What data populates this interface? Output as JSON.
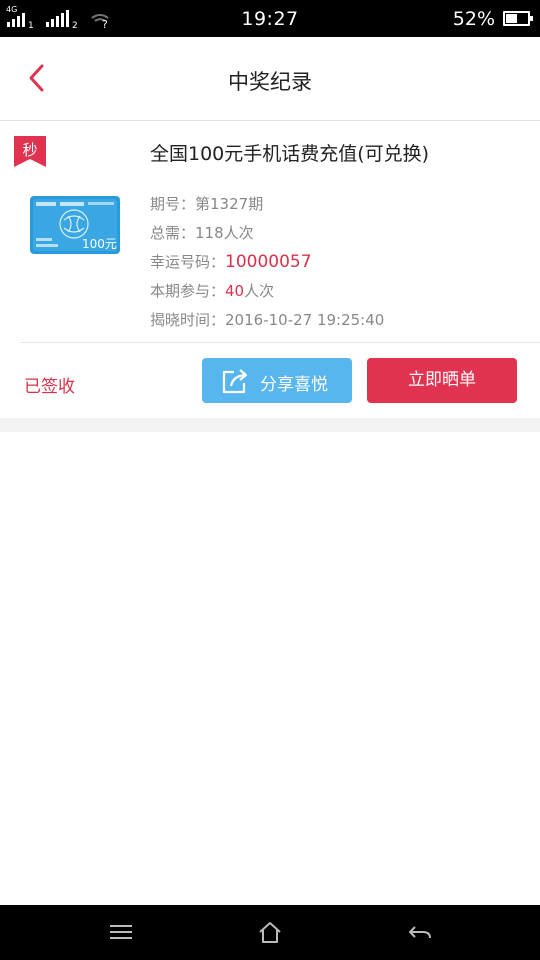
{
  "status_bar": {
    "network_type": "4G",
    "sim1": "1",
    "sim2": "2",
    "wifi_unknown": "?",
    "time": "19:27",
    "battery_percent": "52%",
    "battery_level": 0.52
  },
  "header": {
    "title": "中奖纪录",
    "back_icon": "chevron-left-icon"
  },
  "colors": {
    "accent_red": "#e0334f",
    "text_red": "#d9314b",
    "share_blue": "#58b6ef"
  },
  "record": {
    "badge": "秒",
    "product_title": "全国100元手机话费充值(可兑换)",
    "card_value": "100元",
    "period_label": "期号：",
    "period_value": "第1327期",
    "total_label": "总需：",
    "total_value": "118人次",
    "lucky_label": "幸运号码：",
    "lucky_value": "10000057",
    "joined_label": "本期参与：",
    "joined_count": "40",
    "joined_unit": "人次",
    "reveal_label": "揭晓时间：",
    "reveal_value": "2016-10-27 19:25:40",
    "status": "已签收",
    "share_label": "分享喜悦",
    "showoff_label": "立即晒单"
  },
  "nav_bar": {
    "menu_icon": "menu-icon",
    "home_icon": "home-icon",
    "back_icon": "back-arrow-icon"
  }
}
